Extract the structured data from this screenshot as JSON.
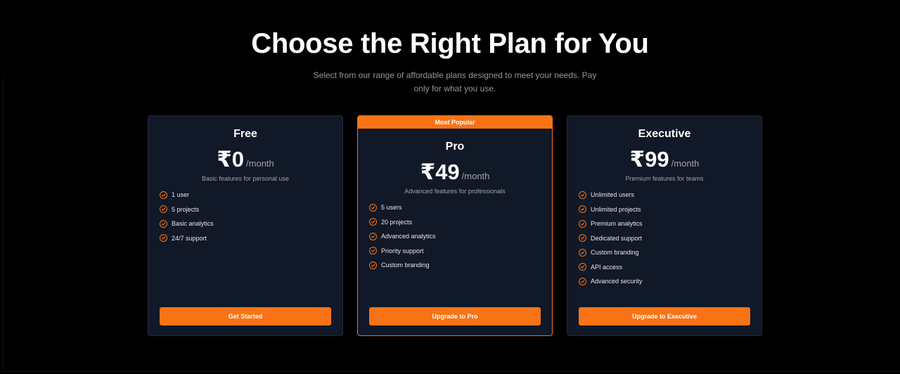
{
  "hero": {
    "title": "Choose the Right Plan for You",
    "subtitle": "Select from our range of affordable plans designed to meet your needs. Pay only for what you use."
  },
  "colors": {
    "background": "#000000",
    "card": "#111827",
    "accent": "#f97316",
    "muted_text": "#9ca3af"
  },
  "plans": [
    {
      "name": "Free",
      "price": "₹0",
      "period": "/month",
      "description": "Basic features for personal use",
      "features": [
        "1 user",
        "5 projects",
        "Basic analytics",
        "24/7 support"
      ],
      "cta": "Get Started"
    },
    {
      "badge": "Most Popular",
      "name": "Pro",
      "price": "₹49",
      "period": "/month",
      "description": "Advanced features for professionals",
      "features": [
        "5 users",
        "20 projects",
        "Advanced analytics",
        "Priority support",
        "Custom branding"
      ],
      "cta": "Upgrade to Pro"
    },
    {
      "name": "Executive",
      "price": "₹99",
      "period": "/month",
      "description": "Premium features for teams",
      "features": [
        "Unlimited users",
        "Unlimited projects",
        "Premium analytics",
        "Dedicated support",
        "Custom branding",
        "API access",
        "Advanced security"
      ],
      "cta": "Upgrade to Executive"
    }
  ]
}
